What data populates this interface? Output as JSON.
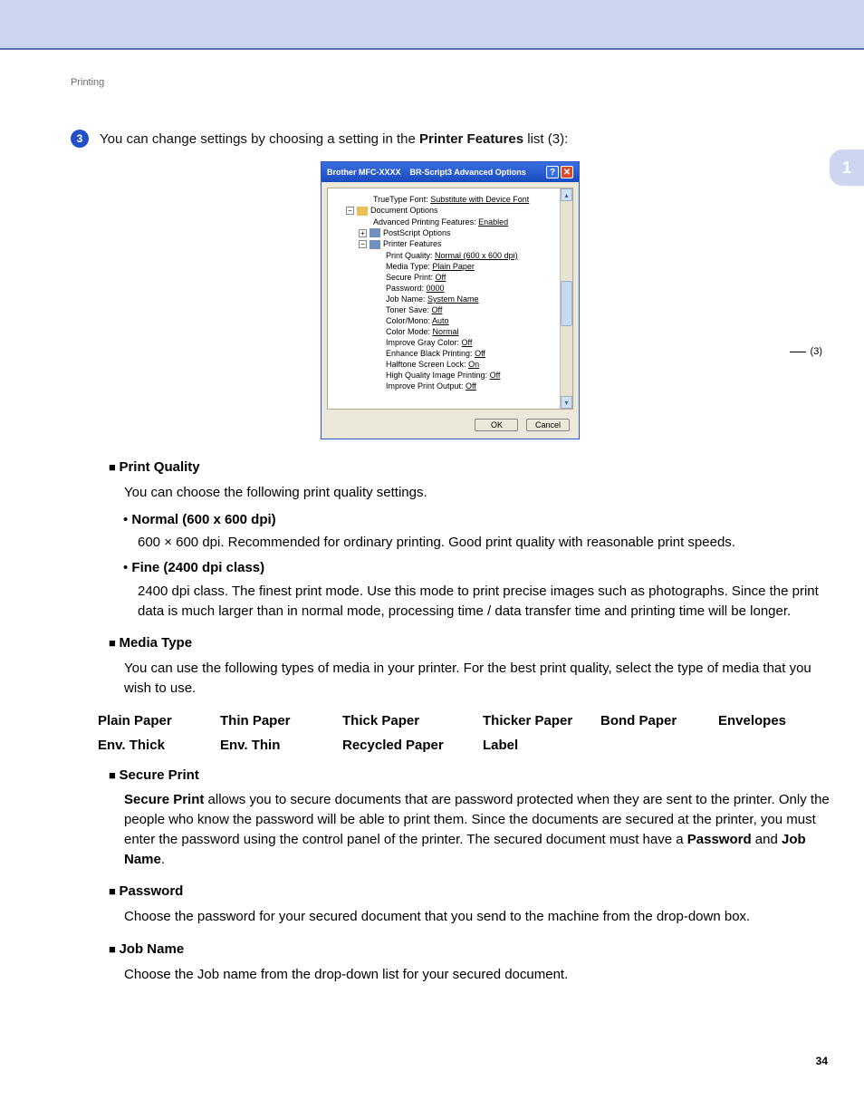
{
  "breadcrumb": "Printing",
  "side_tab": "1",
  "step": {
    "num": "3",
    "text_pre": "You can change settings by choosing a setting in the ",
    "text_bold": "Printer Features",
    "text_post": " list (3):"
  },
  "dialog": {
    "title_left": "Brother MFC-XXXX",
    "title_right": "BR-Script3 Advanced Options",
    "tree": {
      "truetype_label": "TrueType Font:",
      "truetype_value": "Substitute with Device Font",
      "doc_options": "Document Options",
      "adv_printing_label": "Advanced Printing Features:",
      "adv_printing_value": "Enabled",
      "postscript": "PostScript Options",
      "printer_features": "Printer Features",
      "items": [
        {
          "label": "Print Quality:",
          "value": "Normal (600 x 600 dpi)"
        },
        {
          "label": "Media Type:",
          "value": "Plain Paper"
        },
        {
          "label": "Secure Print:",
          "value": "Off"
        },
        {
          "label": "Password:",
          "value": "0000"
        },
        {
          "label": "Job Name:",
          "value": "System Name"
        },
        {
          "label": "Toner Save:",
          "value": "Off"
        },
        {
          "label": "Color/Mono:",
          "value": "Auto"
        },
        {
          "label": "Color Mode:",
          "value": "Normal"
        },
        {
          "label": "Improve Gray Color:",
          "value": "Off"
        },
        {
          "label": "Enhance Black Printing:",
          "value": "Off"
        },
        {
          "label": "Halftone Screen Lock:",
          "value": "On"
        },
        {
          "label": "High Quality Image Printing:",
          "value": "Off"
        },
        {
          "label": "Improve Print Output:",
          "value": "Off"
        }
      ]
    },
    "ok": "OK",
    "cancel": "Cancel",
    "callout": "(3)"
  },
  "features": {
    "print_quality": {
      "head": "Print Quality",
      "desc": "You can choose the following print quality settings.",
      "normal_head": "Normal (600 x 600 dpi)",
      "normal_desc": "600 × 600 dpi. Recommended for ordinary printing. Good print quality with reasonable print speeds.",
      "fine_head": "Fine (2400 dpi class)",
      "fine_desc": "2400 dpi class. The finest print mode. Use this mode to print precise images such as photographs. Since the print data is much larger than in normal mode, processing time / data transfer time and printing time will be longer."
    },
    "media_type": {
      "head": "Media Type",
      "desc": "You can use the following types of media in your printer. For the best print quality, select the type of media that you wish to use.",
      "grid": [
        [
          "Plain Paper",
          "Thin Paper",
          "Thick Paper",
          "Thicker Paper",
          "Bond Paper",
          "Envelopes"
        ],
        [
          "Env. Thick",
          "Env. Thin",
          "Recycled Paper",
          "Label",
          "",
          ""
        ]
      ]
    },
    "secure_print": {
      "head": "Secure Print",
      "desc_bold": "Secure Print",
      "desc_rest": " allows you to secure documents that are password protected when they are sent to the printer. Only the people who know the password will be able to print them. Since the documents are secured at the printer, you must enter the password using the control panel of the printer. The secured document must have a ",
      "desc_bold2": "Password",
      "desc_mid": " and ",
      "desc_bold3": "Job Name",
      "desc_end": "."
    },
    "password": {
      "head": "Password",
      "desc": "Choose the password for your secured document that you send to the machine from the drop-down box."
    },
    "job_name": {
      "head": "Job Name",
      "desc": "Choose the Job name from the drop-down list for your secured document."
    }
  },
  "page_num": "34"
}
